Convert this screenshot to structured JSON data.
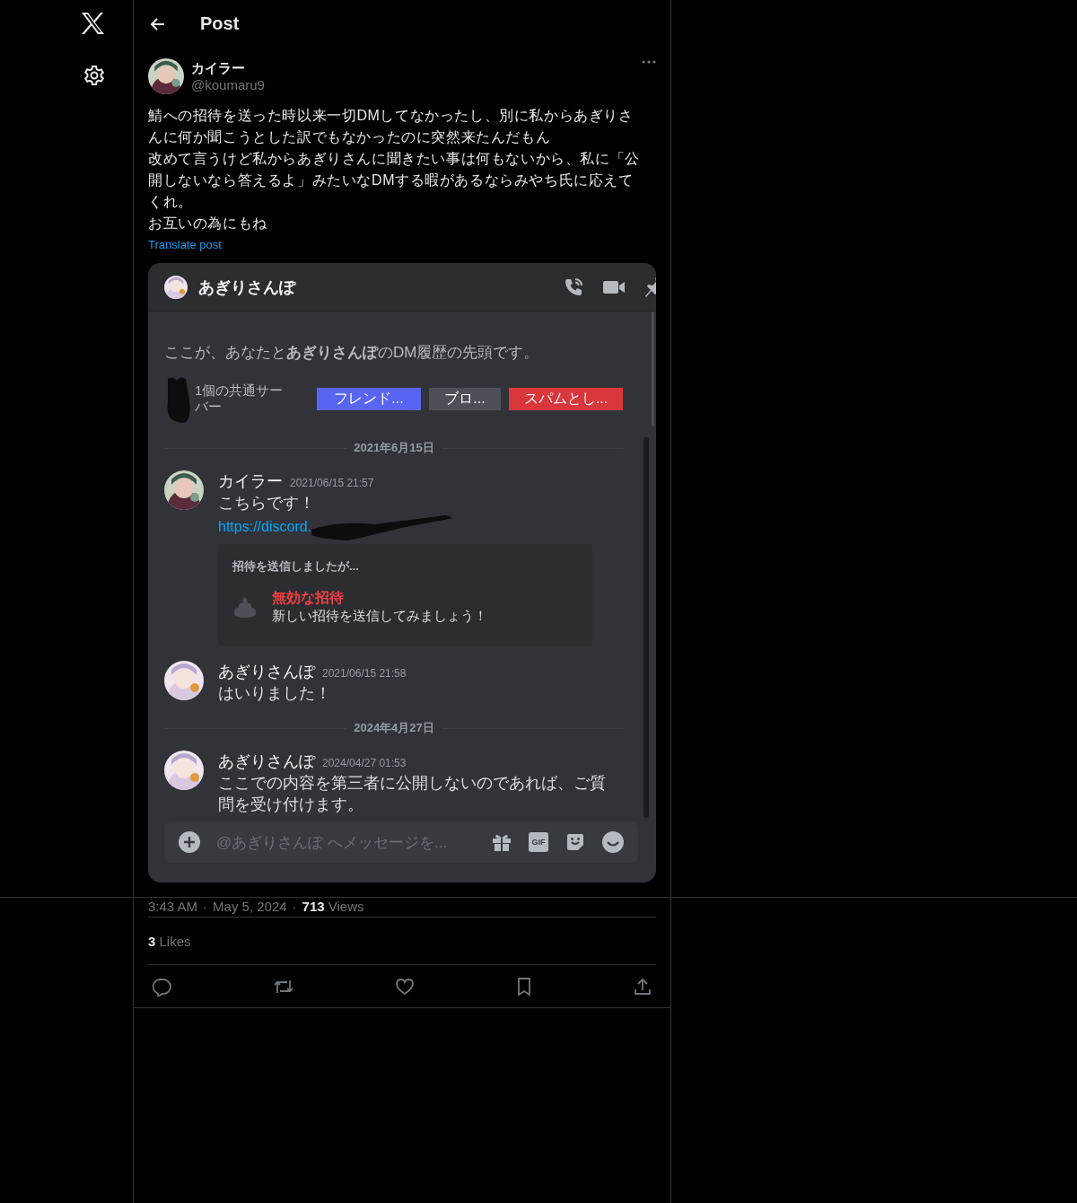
{
  "header": {
    "title": "Post"
  },
  "post": {
    "author": {
      "name": "カイラー",
      "handle": "@koumaru9"
    },
    "paragraphs": [
      "鯖への招待を送った時以来一切DMしてなかったし、別に私からあぎりさんに何か聞こうとした訳でもなかったのに突然来たんだもん",
      "改めて言うけど私からあぎりさんに聞きたい事は何もないから、私に「公開しないなら答えるよ」みたいなDMする暇があるならみやち氏に応えてくれ。",
      "お互いの為にもね"
    ],
    "translate_link": "Translate post",
    "screenshot": {
      "channel_name": "あぎりさんぽ",
      "intro": "ここが、あなたと**あぎりさんぽ**のDM履歴の先頭です。",
      "mutual_servers": "1個の共通サーバー",
      "buttons": [
        {
          "label": "フレンド...",
          "kind": "primary"
        },
        {
          "label": "ブロ...",
          "kind": "secondary"
        },
        {
          "label": "スパムとし...",
          "kind": "danger"
        }
      ],
      "timeline": [
        {
          "kind": "date",
          "text": "2021年6月15日"
        },
        {
          "kind": "message",
          "author": "カイラー",
          "time": "2021/06/15 21:57",
          "lines": [
            "こちらです！"
          ],
          "link": "https://discord.",
          "embed": {
            "heading": "招待を送信しましたが...",
            "title": "無効な招待",
            "subtitle": "新しい招待を送信してみましょう！"
          }
        },
        {
          "kind": "message",
          "author": "あぎりさんぽ",
          "time": "2021/06/15 21:58",
          "lines": [
            "はいりました！"
          ]
        },
        {
          "kind": "date",
          "text": "2024年4月27日"
        },
        {
          "kind": "message",
          "author": "あぎりさんぽ",
          "time": "2024/04/27 01:53",
          "lines": [
            "ここでの内容を第三者に公開しないのであれば、ご質問を受け付けます。"
          ]
        }
      ],
      "composer": {
        "placeholder": "@あぎりさんぽ へメッセージを...",
        "gif_label": "GIF"
      }
    },
    "time": "3:43 AM",
    "separator_1": "·",
    "date": "May 5, 2024",
    "separator_2": "·",
    "views_count": "713",
    "views_label": "Views",
    "likes_count": "3",
    "likes_label": "Likes"
  }
}
